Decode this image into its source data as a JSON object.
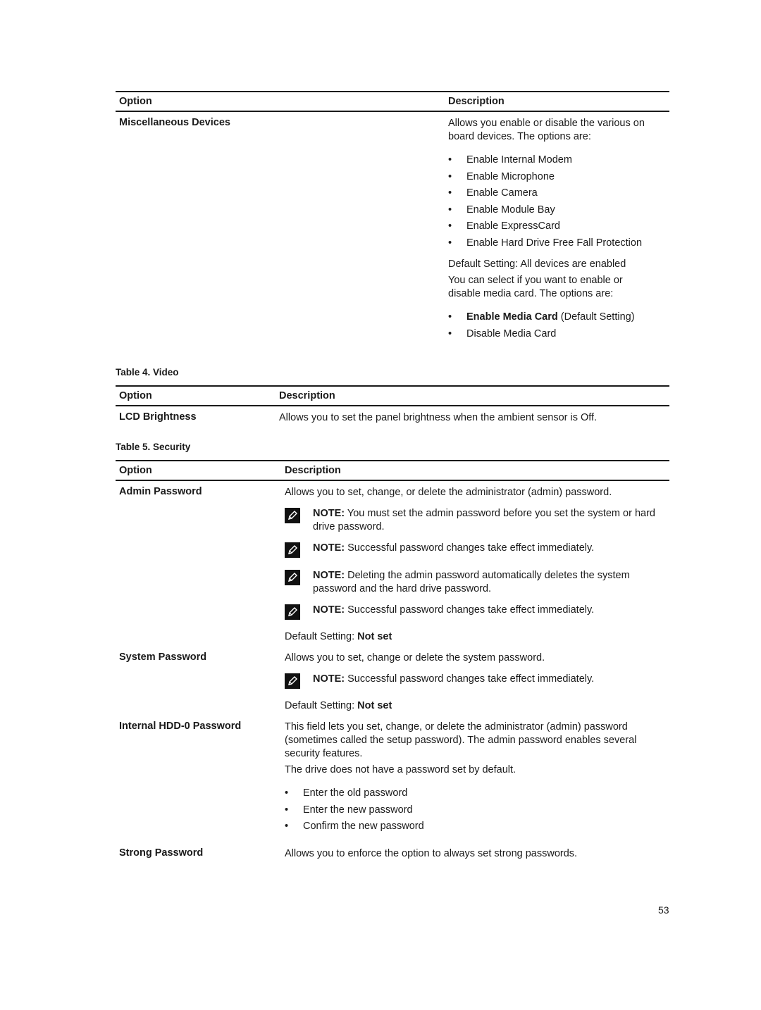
{
  "table3": {
    "header": {
      "option": "Option",
      "description": "Description"
    },
    "row": {
      "option": "Miscellaneous Devices",
      "intro": "Allows you enable or disable the various on board devices. The options are:",
      "devices": [
        "Enable Internal Modem",
        "Enable Microphone",
        "Enable Camera",
        "Enable Module Bay",
        "Enable ExpressCard",
        "Enable Hard Drive Free Fall Protection"
      ],
      "default_setting": "Default Setting: All devices are enabled",
      "media_intro": "You can select if you want to enable or disable media card. The options are:",
      "media_options": [
        {
          "bold": "Enable Media Card",
          "rest": " (Default Setting)"
        },
        {
          "bold": "",
          "rest": "Disable Media Card"
        }
      ]
    }
  },
  "table4": {
    "caption": "Table 4. Video",
    "header": {
      "option": "Option",
      "description": "Description"
    },
    "rows": [
      {
        "option": "LCD Brightness",
        "description": "Allows you to set the panel brightness when the ambient sensor is Off."
      }
    ]
  },
  "table5": {
    "caption": "Table 5. Security",
    "header": {
      "option": "Option",
      "description": "Description"
    },
    "admin": {
      "option": "Admin Password",
      "description": "Allows you to set, change, or delete the administrator (admin) password.",
      "notes": [
        {
          "label": "NOTE:",
          "text": " You must set the admin password before you set the system or hard drive password."
        },
        {
          "label": "NOTE:",
          "text": " Successful password changes take effect immediately."
        },
        {
          "label": "NOTE:",
          "text": " Deleting the admin password automatically deletes the system password and the hard drive password."
        },
        {
          "label": "NOTE:",
          "text": " Successful password changes take effect immediately."
        }
      ],
      "default_label": "Default Setting: ",
      "default_value": "Not set"
    },
    "system": {
      "option": "System Password",
      "description": "Allows you to set, change or delete the system password.",
      "notes": [
        {
          "label": "NOTE:",
          "text": " Successful password changes take effect immediately."
        }
      ],
      "default_label": "Default Setting: ",
      "default_value": "Not set"
    },
    "hdd": {
      "option": "Internal HDD-0 Password",
      "description": "This field lets you set, change, or delete the administrator (admin) password (sometimes called the setup password). The admin password enables several security features.",
      "extra": "The drive does not have a password set by default.",
      "steps": [
        "Enter the old password",
        "Enter the new password",
        "Confirm the new password"
      ]
    },
    "strong": {
      "option": "Strong Password",
      "description": "Allows you to enforce the option to always set strong passwords."
    }
  },
  "page_number": "53",
  "icons": {
    "note": "pencil-note-icon"
  }
}
